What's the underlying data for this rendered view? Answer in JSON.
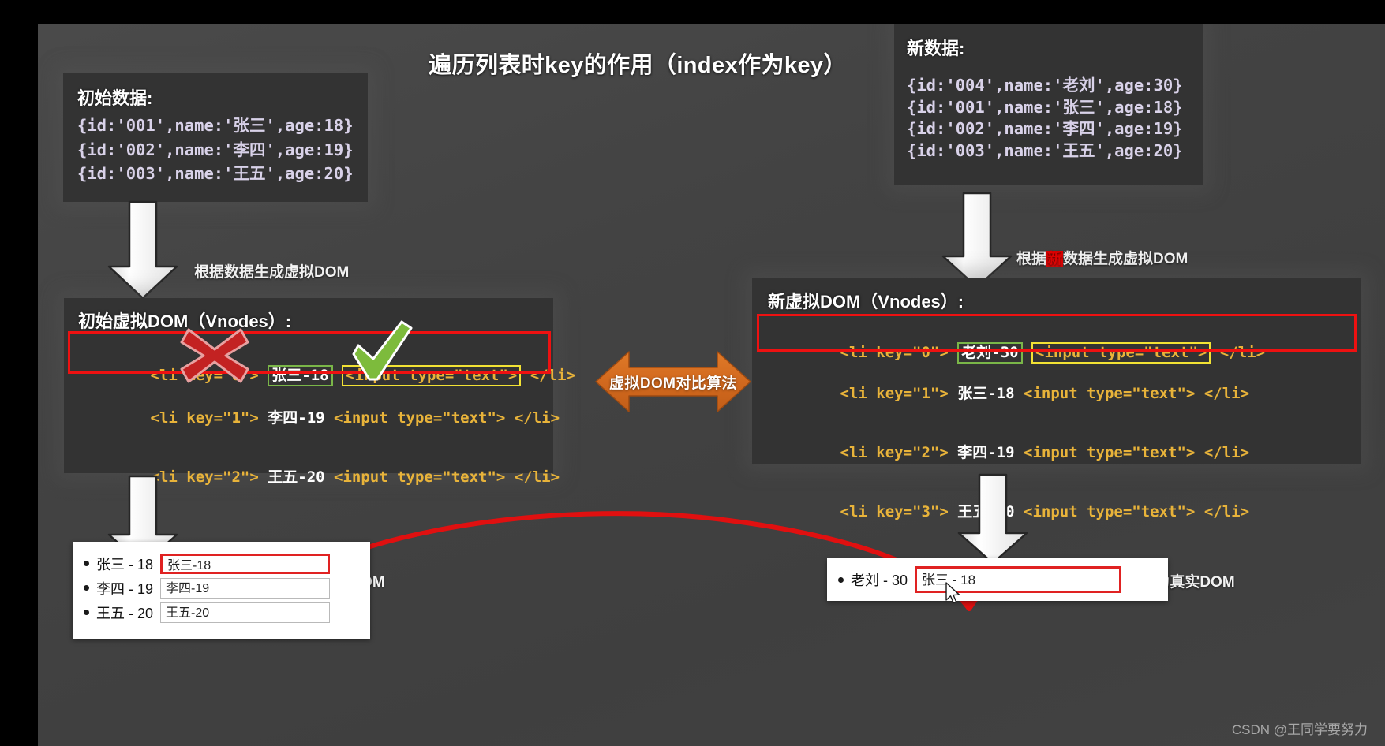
{
  "slide": {
    "title": "遍历列表时key的作用（index作为key）",
    "watermark": "CSDN @王同学要努力"
  },
  "initial_data": {
    "title": "初始数据:",
    "rows": [
      "{id:'001',name:'张三',age:18}",
      "{id:'002',name:'李四',age:19}",
      "{id:'003',name:'王五',age:20}"
    ]
  },
  "new_data": {
    "title": "新数据:",
    "rows": [
      "{id:'004',name:'老刘',age:30}",
      "{id:'001',name:'张三',age:18}",
      "{id:'002',name:'李四',age:19}",
      "{id:'003',name:'王五',age:20}"
    ]
  },
  "old_vdom": {
    "title": "初始虚拟DOM（Vnodes）:",
    "rows": [
      {
        "open": "<li key=\"0\">",
        "person": "张三-18",
        "input": "<input type=\"text\">",
        "close": "</li>",
        "highlight": true
      },
      {
        "open": "<li key=\"1\">",
        "person": "李四-19",
        "input": "<input type=\"text\">",
        "close": "</li>",
        "highlight": false
      },
      {
        "open": "<li key=\"2\">",
        "person": "王五-20",
        "input": "<input type=\"text\">",
        "close": "</li>",
        "highlight": false
      }
    ]
  },
  "new_vdom": {
    "title": "新虚拟DOM（Vnodes）:",
    "rows": [
      {
        "open": "<li key=\"0\">",
        "person": "老刘-30",
        "input": "<input type=\"text\">",
        "close": "</li>",
        "highlight": true
      },
      {
        "open": "<li key=\"1\">",
        "person": "张三-18",
        "input": "<input type=\"text\">",
        "close": "</li>",
        "highlight": false
      },
      {
        "open": "<li key=\"2\">",
        "person": "李四-19",
        "input": "<input type=\"text\">",
        "close": "</li>",
        "highlight": false
      },
      {
        "open": "<li key=\"3\">",
        "person": "王五-20",
        "input": "<input type=\"text\">",
        "close": "</li>",
        "highlight": false
      }
    ]
  },
  "arrows": {
    "gen_vdom_left": "根据数据生成虚拟DOM",
    "gen_vdom_right_prefix": "根据",
    "gen_vdom_right_marked": "新",
    "gen_vdom_right_suffix": "数据生成虚拟DOM",
    "to_real_dom_left": "将虚拟DOM转为真实DOM",
    "to_real_dom_right": "将虚拟DOM转为真实DOM",
    "compare_label": "虚拟DOM对比算法"
  },
  "real_dom_left": {
    "rows": [
      {
        "label": "张三 - 18",
        "input_value": "张三-18",
        "flagged": true
      },
      {
        "label": "李四 - 19",
        "input_value": "李四-19",
        "flagged": false
      },
      {
        "label": "王五 - 20",
        "input_value": "王五-20",
        "flagged": false
      }
    ]
  },
  "real_dom_right": {
    "rows": [
      {
        "label": "老刘 - 30",
        "input_value": "张三 - 18",
        "flagged": true
      }
    ]
  },
  "colors": {
    "background": "#444444",
    "panel": "#333333",
    "accent_orange": "#d2691e",
    "highlight_red": "#ee1111",
    "highlight_green": "#7ab648",
    "highlight_yellow": "#f2e234",
    "code_string": "#93c47d",
    "code_key": "#b4a7d6",
    "code_tag": "#e8c14a"
  },
  "markers": {
    "cross": "wrong-mark",
    "check": "correct-mark"
  }
}
